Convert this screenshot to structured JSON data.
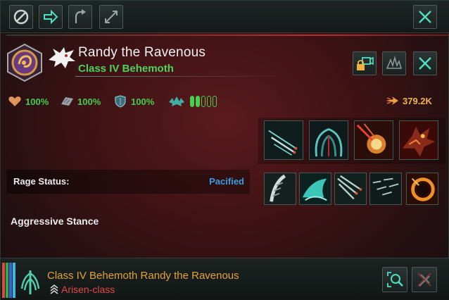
{
  "header": {
    "name": "Randy the Ravenous",
    "class_label": "Class IV Behemoth"
  },
  "toolbar": {
    "buttons": [
      "ban-icon",
      "move-arrow-icon",
      "return-arrow-icon",
      "resize-icon"
    ],
    "close": "close-icon"
  },
  "stats": {
    "hull": "100%",
    "armor": "100%",
    "shields": "100%",
    "rage_pips_filled": 2,
    "rage_pips_total": 5,
    "power": "379.2K"
  },
  "rage": {
    "label": "Rage Status:",
    "value": "Pacified"
  },
  "stance": "Aggressive Stance",
  "footer": {
    "title": "Class IV Behemoth Randy the Ravenous",
    "subtitle": "Arisen-class",
    "stripe_colors": [
      "#e04a3a",
      "#3aa64a",
      "#2a6bd8",
      "#3fb7e0"
    ]
  },
  "colors": {
    "accent_green": "#45cf4d",
    "accent_orange": "#e2a23a",
    "status_blue": "#3a9be0",
    "warning_red": "#e24848"
  }
}
